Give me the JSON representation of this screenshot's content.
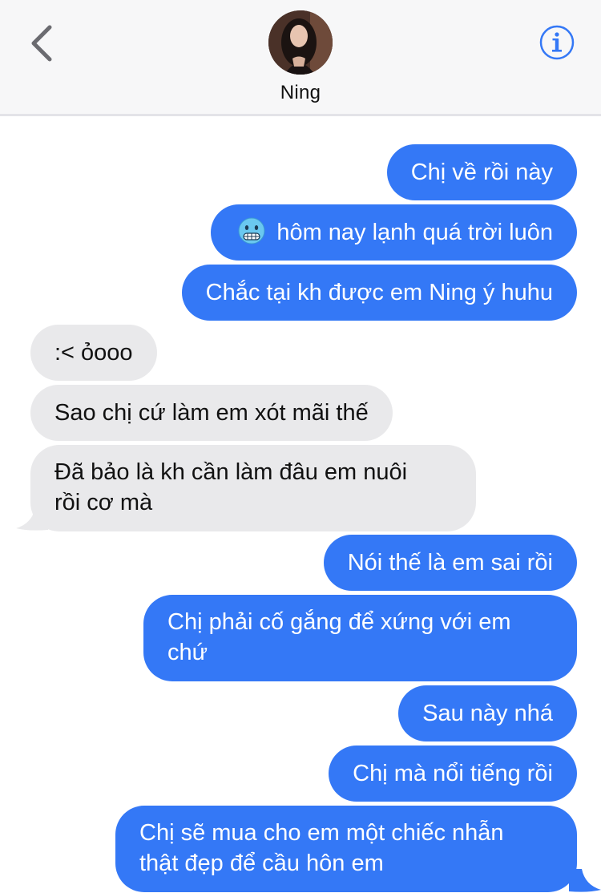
{
  "header": {
    "contact_name": "Ning",
    "back_icon": "chevron-left-icon",
    "info_icon": "info-circle-icon"
  },
  "colors": {
    "outgoing": "#3478f6",
    "incoming": "#e9e9eb",
    "accent": "#3478f6"
  },
  "messages": [
    {
      "dir": "out",
      "text": "Chị về rồi này"
    },
    {
      "dir": "out",
      "emoji": "cold-face",
      "text": "hôm nay lạnh quá trời luôn"
    },
    {
      "dir": "out",
      "text": "Chắc tại kh được em Ning ý huhu"
    },
    {
      "dir": "in",
      "text": ":< ỏooo"
    },
    {
      "dir": "in",
      "text": "Sao chị cứ làm em xót mãi thế"
    },
    {
      "dir": "in",
      "line1": "Đã bảo là kh cần làm đâu em nuôi",
      "line2": "rồi cơ mà"
    },
    {
      "dir": "out",
      "text": "Nói thế là em sai rồi"
    },
    {
      "dir": "out",
      "line1": "Chị phải cố gắng để xứng với em",
      "line2": "chứ"
    },
    {
      "dir": "out",
      "text": "Sau này nhá"
    },
    {
      "dir": "out",
      "text": "Chị mà nổi tiếng rồi"
    },
    {
      "dir": "out",
      "line1": "Chị sẽ mua cho em một chiếc nhẫn",
      "line2": "thật đẹp để cầu hôn em"
    }
  ]
}
